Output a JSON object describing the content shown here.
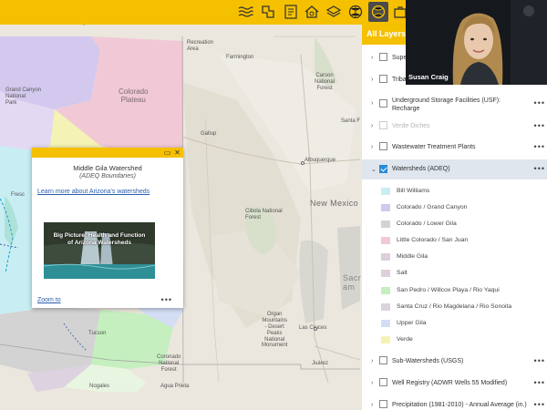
{
  "map": {
    "labels": {
      "kingman": "Kingman",
      "recreation_area": "Recreation\nArea",
      "grand_canyon": "Grand Canyon\nNational\nPark",
      "colorado_plateau": "Colorado\nPlateau",
      "farmington": "Farmington",
      "carson": "Carson\nNational\nForest",
      "santa_fe": "Santa F",
      "gallup": "Gallup",
      "albuquerque": "Albuquerque",
      "new_mexico": "New Mexico",
      "cibola": "Cibola National\nForest",
      "frescno": "Fresc",
      "sacramento": "Sacr\nam",
      "las_cruces": "Las Cruces",
      "organ": "Organ\nMountains\n- Desert\nPeaks\nNational\nMonument",
      "tucson": "Tucson",
      "coronado": "Coronado\nNational\nForest",
      "nogales": "Nogales",
      "agua_prieta": "Agua Prieta",
      "juarez": "Juárez"
    }
  },
  "toolbar": {
    "buttons": [
      {
        "icon": "water-waves-icon"
      },
      {
        "icon": "puzzle-map-icon"
      },
      {
        "icon": "print-document-icon"
      },
      {
        "icon": "home-map-icon"
      },
      {
        "icon": "layers-stack-icon"
      },
      {
        "icon": "ball-basemap-icon"
      },
      {
        "icon": "briefcase-icon"
      }
    ]
  },
  "popup": {
    "title": "Middle Gila Watershed",
    "subtitle": "(ADEQ Boundaries)",
    "link": "Learn more about Arizona's watersheds",
    "thumbnail_caption": "Big Picture: Health and Function\nof Arizona Watersheds",
    "zoom_label": "Zoom to",
    "more_label": "•••"
  },
  "panel": {
    "header": "All Layers",
    "layers": [
      {
        "label": "Supe",
        "checked": false,
        "dim": false,
        "dots": false
      },
      {
        "label": "Triba",
        "checked": false,
        "dim": false,
        "dots": false
      },
      {
        "label": "Underground Storage Facilities (USF):\nRecharge",
        "checked": false,
        "dim": false,
        "dots": true
      },
      {
        "label": "Verde Diches",
        "checked": false,
        "dim": true,
        "dots": true
      },
      {
        "label": "Wastewater Treatment Plants",
        "checked": false,
        "dim": false,
        "dots": true
      },
      {
        "label": "Watersheds (ADEQ)",
        "checked": true,
        "dim": false,
        "dots": true
      }
    ],
    "legend": [
      {
        "label": "Bill Williams",
        "color": "#c8eef4"
      },
      {
        "label": "Colorado / Grand Canyon",
        "color": "#d3c8ee"
      },
      {
        "label": "Colorado / Lower Gila",
        "color": "#d3d3d3"
      },
      {
        "label": "Little Colorado / San Juan",
        "color": "#f1c9d6"
      },
      {
        "label": "Middle Gila",
        "color": "#ddcfdc"
      },
      {
        "label": "Salt",
        "color": "#ddcfdc"
      },
      {
        "label": "San Pedro / Willcox Playa / Rio Yaqui",
        "color": "#c5efbf"
      },
      {
        "label": "Santa Cruz / Rio Magdelana / Rio Sonoita",
        "color": "#ddd2e0"
      },
      {
        "label": "Upper Gila",
        "color": "#d3ddf4"
      },
      {
        "label": "Verde",
        "color": "#f4f2b4"
      }
    ],
    "bottom_layers": [
      {
        "label": "Sub-Watersheds (USGS)",
        "checked": false,
        "dots": true
      },
      {
        "label": "Well Registry (ADWR Wells 55 Modified)",
        "checked": false,
        "dots": true
      },
      {
        "label": "Precipitation (1981-2010) - Annual Average (in.)",
        "checked": false,
        "dots": true
      }
    ]
  },
  "webcam": {
    "name": "Susan Craig"
  }
}
